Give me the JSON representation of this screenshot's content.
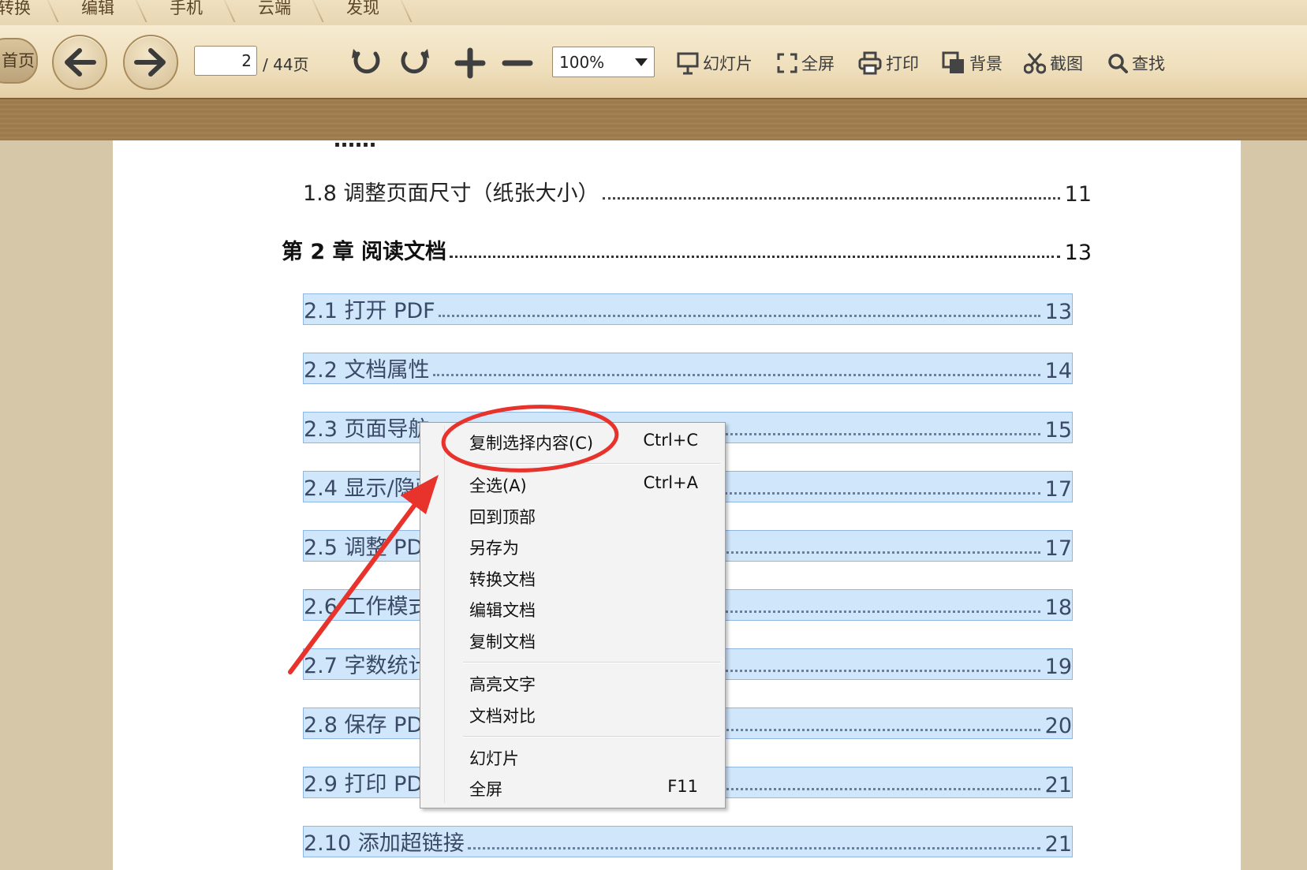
{
  "tabs": [
    "转换",
    "编辑",
    "手机",
    "云端",
    "发现"
  ],
  "toolbar": {
    "home_label": "首页",
    "page_current": "2",
    "page_total": "/ 44页",
    "zoom": "100%",
    "slideshow": "幻灯片",
    "fullscreen": "全屏",
    "print": "打印",
    "background": "背景",
    "screenshot": "截图",
    "find": "查找"
  },
  "document": {
    "partial_top": "……",
    "entries": [
      {
        "text": "1.8 调整页面尺寸（纸张大小）",
        "page": "11",
        "style": "normal"
      },
      {
        "text": "第 2 章  阅读文档",
        "page": "13",
        "style": "chapter"
      },
      {
        "text": "2.1 打开 PDF",
        "page": "13",
        "style": "selected"
      },
      {
        "text": "2.2 文档属性",
        "page": "14",
        "style": "selected"
      },
      {
        "text": "2.3 页面导航",
        "page": "15",
        "style": "selected"
      },
      {
        "text": "2.4 显示/隐藏",
        "page": "17",
        "style": "selected"
      },
      {
        "text": "2.5 调整 PDF",
        "page": "17",
        "style": "selected"
      },
      {
        "text": "2.6 工作模式",
        "page": "18",
        "style": "selected"
      },
      {
        "text": "2.7 字数统计",
        "page": "19",
        "style": "selected"
      },
      {
        "text": "2.8 保存 PDF",
        "page": "20",
        "style": "selected"
      },
      {
        "text": "2.9 打印 PDF",
        "page": "21",
        "style": "selected"
      },
      {
        "text": "2.10 添加超链接",
        "page": "21",
        "style": "selected"
      }
    ]
  },
  "context_menu": {
    "items": [
      {
        "label": "复制选择内容(C)",
        "shortcut": "Ctrl+C",
        "group": 1
      },
      {
        "label": "全选(A)",
        "shortcut": "Ctrl+A",
        "group": 2
      },
      {
        "label": "回到顶部",
        "shortcut": "",
        "group": 2
      },
      {
        "label": "另存为",
        "shortcut": "",
        "group": 2
      },
      {
        "label": "转换文档",
        "shortcut": "",
        "group": 2
      },
      {
        "label": "编辑文档",
        "shortcut": "",
        "group": 2
      },
      {
        "label": "复制文档",
        "shortcut": "",
        "group": 2
      },
      {
        "label": "高亮文字",
        "shortcut": "",
        "group": 3
      },
      {
        "label": "文档对比",
        "shortcut": "",
        "group": 3
      },
      {
        "label": "幻灯片",
        "shortcut": "",
        "group": 4
      },
      {
        "label": "全屏",
        "shortcut": "F11",
        "group": 4
      }
    ]
  },
  "colors": {
    "selection": "#d0e6fb",
    "annotation": "#e8322c",
    "toolbar": "#efdfbc"
  }
}
